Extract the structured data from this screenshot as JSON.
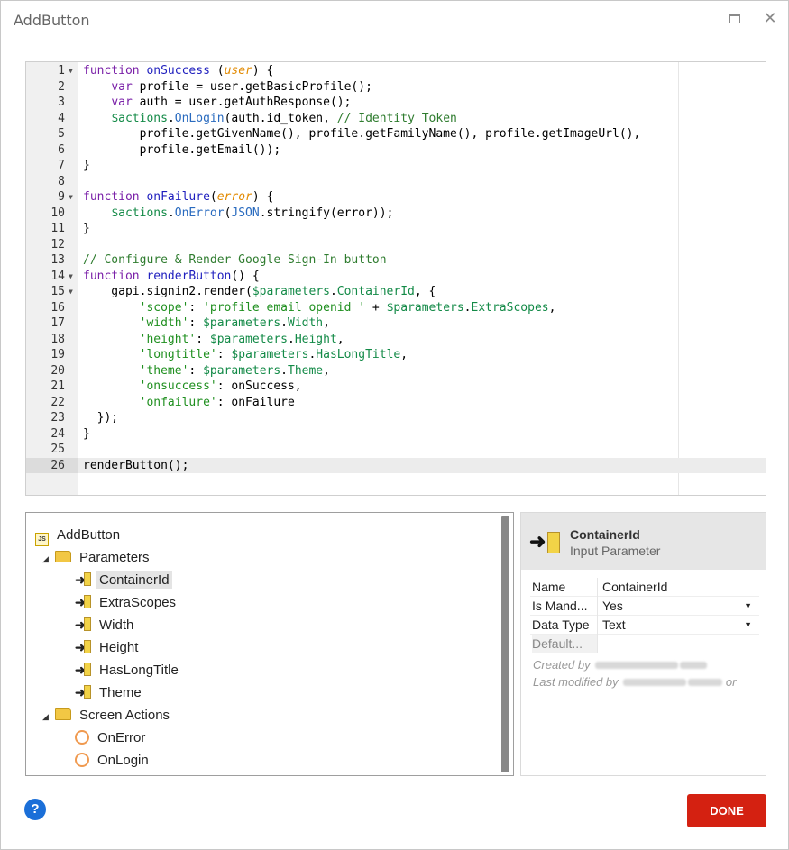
{
  "window": {
    "title": "AddButton",
    "maximize_icon": "maximize-icon",
    "close_icon": "close-icon"
  },
  "editor": {
    "active_line": 26,
    "lines": [
      {
        "n": "1",
        "fold": true
      },
      {
        "n": "2"
      },
      {
        "n": "3"
      },
      {
        "n": "4"
      },
      {
        "n": "5"
      },
      {
        "n": "6"
      },
      {
        "n": "7"
      },
      {
        "n": "8"
      },
      {
        "n": "9",
        "fold": true
      },
      {
        "n": "10"
      },
      {
        "n": "11"
      },
      {
        "n": "12"
      },
      {
        "n": "13"
      },
      {
        "n": "14",
        "fold": true
      },
      {
        "n": "15",
        "fold": true
      },
      {
        "n": "16"
      },
      {
        "n": "17"
      },
      {
        "n": "18"
      },
      {
        "n": "19"
      },
      {
        "n": "20"
      },
      {
        "n": "21"
      },
      {
        "n": "22"
      },
      {
        "n": "23"
      },
      {
        "n": "24"
      },
      {
        "n": "25"
      },
      {
        "n": "26"
      }
    ]
  },
  "tree": {
    "root": "AddButton",
    "parameters_label": "Parameters",
    "parameters": [
      "ContainerId",
      "ExtraScopes",
      "Width",
      "Height",
      "HasLongTitle",
      "Theme"
    ],
    "selected": "ContainerId",
    "actions_label": "Screen Actions",
    "actions": [
      "OnError",
      "OnLogin"
    ]
  },
  "props": {
    "name": "ContainerId",
    "type": "Input Parameter",
    "rows": [
      {
        "key": "Name",
        "value": "ContainerId"
      },
      {
        "key": "Is Mand...",
        "value": "Yes",
        "dropdown": true
      },
      {
        "key": "Data Type",
        "value": "Text",
        "dropdown": true
      },
      {
        "key": "Default...",
        "value": ""
      }
    ],
    "created_label": "Created by",
    "modified_label": "Last modified by",
    "modified_suffix": "or"
  },
  "footer": {
    "help_label": "?",
    "done_label": "DONE"
  },
  "colors": {
    "done_button": "#d42111",
    "help_button": "#1b6fd8",
    "keyword": "#7a20a8",
    "function_name": "#1e1ebe",
    "comment": "#2f7c2f"
  }
}
